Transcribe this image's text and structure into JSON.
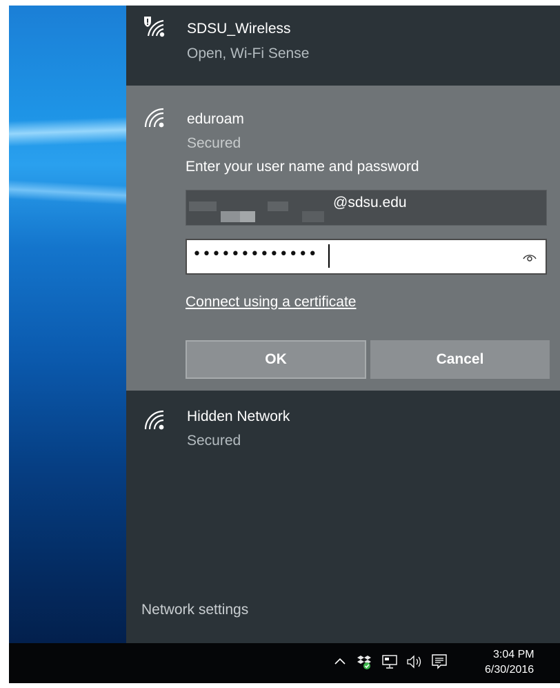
{
  "networks": [
    {
      "name": "SDSU_Wireless",
      "status": "Open, Wi-Fi Sense",
      "icon": "wifi-shield-icon"
    },
    {
      "name": "eduroam",
      "status": "Secured",
      "icon": "wifi-icon"
    },
    {
      "name": "Hidden Network",
      "status": "Secured",
      "icon": "wifi-icon"
    }
  ],
  "login": {
    "prompt": "Enter your user name and password",
    "username_value": "@sdsu.edu",
    "password_value": "•••••••••••••",
    "certificate_link": "Connect using a certificate",
    "ok_label": "OK",
    "cancel_label": "Cancel"
  },
  "network_settings_label": "Network settings",
  "taskbar": {
    "time": "3:04 PM",
    "date": "6/30/2016",
    "tray_icons": [
      "chevron-up-icon",
      "dropbox-icon",
      "network-icon",
      "volume-icon",
      "action-center-icon"
    ]
  },
  "colors": {
    "flyout_bg": "#2b3338",
    "selected_bg": "#6f7477",
    "button_bg": "#8c9093",
    "taskbar_bg": "#050608"
  }
}
